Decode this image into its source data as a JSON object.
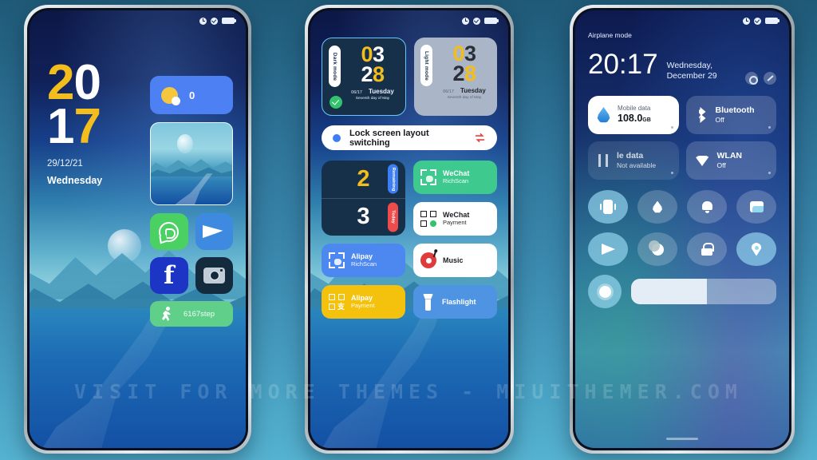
{
  "watermark": "VISIT FOR MORE THEMES - MIUITHEMER.COM",
  "colors": {
    "accent_yellow": "#f2bd1d",
    "accent_blue": "#3d7ef5",
    "accent_green": "#3ec98f",
    "accent_red": "#ee4b4b",
    "dark_card": "#17304a",
    "light_card": "#aab6c8"
  },
  "status_bar": {
    "icons": [
      "alarm-clock-icon",
      "check-circle-icon",
      "battery-icon"
    ]
  },
  "phone_left": {
    "clock": {
      "line1": [
        {
          "text": "2",
          "color": "yellow"
        },
        {
          "text": "0",
          "color": "white"
        }
      ],
      "line2": [
        {
          "text": "1",
          "color": "white"
        },
        {
          "text": "7",
          "color": "yellow"
        }
      ]
    },
    "date": "29/12/21",
    "weekday": "Wednesday",
    "weather": {
      "icon": "sun-icon",
      "temperature": "0"
    },
    "photo_widget_label": "photo-widget",
    "apps": [
      {
        "name": "whatsapp",
        "icon": "whatsapp-icon"
      },
      {
        "name": "telegram",
        "icon": "telegram-icon"
      },
      {
        "name": "facebook",
        "icon": "facebook-icon"
      },
      {
        "name": "camera",
        "icon": "camera-icon"
      }
    ],
    "steps": {
      "icon": "running-icon",
      "value": "6167step"
    }
  },
  "phone_mid": {
    "modes": [
      {
        "label": "Dark mode",
        "clock_top": [
          {
            "text": "0",
            "color": "yellow"
          },
          {
            "text": "3",
            "color": "white"
          }
        ],
        "clock_bottom": [
          {
            "text": "2",
            "color": "white"
          },
          {
            "text": "8",
            "color": "yellow"
          }
        ],
        "date": "06/17",
        "weekday": "Tuesday",
        "subtitle": "Seventh day of May",
        "selected": true
      },
      {
        "label": "Light mode",
        "clock_top": [
          {
            "text": "0",
            "color": "yellow"
          },
          {
            "text": "3",
            "color": "dark"
          }
        ],
        "clock_bottom": [
          {
            "text": "2",
            "color": "dark"
          },
          {
            "text": "8",
            "color": "yellow"
          }
        ],
        "date": "06/17",
        "weekday": "Tuesday",
        "subtitle": "Seventh day of May",
        "selected": false
      }
    ],
    "switch_row": {
      "label": "Lock screen layout switching",
      "dot_icon": "blue-dot-icon",
      "action_icon": "swap-arrows-icon"
    },
    "countdown": {
      "top": {
        "value": "2",
        "badge": "Remaining"
      },
      "bottom": {
        "value": "3",
        "badge": "Today"
      }
    },
    "shortcuts": [
      {
        "title": "WeChat",
        "subtitle": "RichScan",
        "icon": "scan-frame-icon",
        "style": "wechat-scan"
      },
      {
        "title": "WeChat",
        "subtitle": "Payment",
        "icon": "qr-code-icon",
        "style": "wechat-pay"
      },
      {
        "title": "Alipay",
        "subtitle": "RichScan",
        "icon": "scan-frame-icon",
        "style": "alipay-scan"
      },
      {
        "title": "Music",
        "subtitle": "",
        "icon": "vinyl-record-icon",
        "style": "music"
      },
      {
        "title": "Alipay",
        "subtitle": "Payment",
        "icon": "qr-code-icon",
        "style": "alipay-pay"
      },
      {
        "title": "Flashlight",
        "subtitle": "",
        "icon": "flashlight-icon",
        "style": "flashlight"
      }
    ]
  },
  "phone_right": {
    "airplane_label": "Airplane mode",
    "time": "20:17",
    "date": "Wednesday, December 29",
    "header_actions": [
      {
        "name": "settings",
        "icon": "gear-icon"
      },
      {
        "name": "edit",
        "icon": "pencil-icon"
      }
    ],
    "tiles": [
      {
        "title": "Mobile data",
        "value": "108.0",
        "unit": "GB",
        "icon": "data-drop-icon",
        "state": "on"
      },
      {
        "title": "Bluetooth",
        "status": "Off",
        "icon": "bluetooth-icon",
        "state": "off"
      },
      {
        "title": "le data",
        "status": "Not available",
        "icon": "data-arrows-icon",
        "state": "dim"
      },
      {
        "title": "WLAN",
        "status": "Off",
        "icon": "wifi-icon",
        "state": "off"
      }
    ],
    "toggles": [
      {
        "name": "vibrate",
        "icon": "vibrate-icon",
        "state": "active"
      },
      {
        "name": "battery-saver",
        "icon": "drop-icon",
        "state": "inactive"
      },
      {
        "name": "silent",
        "icon": "bell-mute-icon",
        "state": "inactive"
      },
      {
        "name": "screenshot",
        "icon": "screenshot-icon",
        "state": "inactive"
      },
      {
        "name": "cast",
        "icon": "send-icon",
        "state": "active"
      },
      {
        "name": "dnd",
        "icon": "moon-icon",
        "state": "inactive"
      },
      {
        "name": "rotation-lock",
        "icon": "lock-icon",
        "state": "inactive"
      },
      {
        "name": "location",
        "icon": "location-pin-icon",
        "state": "active"
      },
      {
        "name": "brightness",
        "icon": "sun-icon",
        "state": "active"
      }
    ],
    "brightness": {
      "icon": "sun-icon",
      "percent": 52
    }
  }
}
